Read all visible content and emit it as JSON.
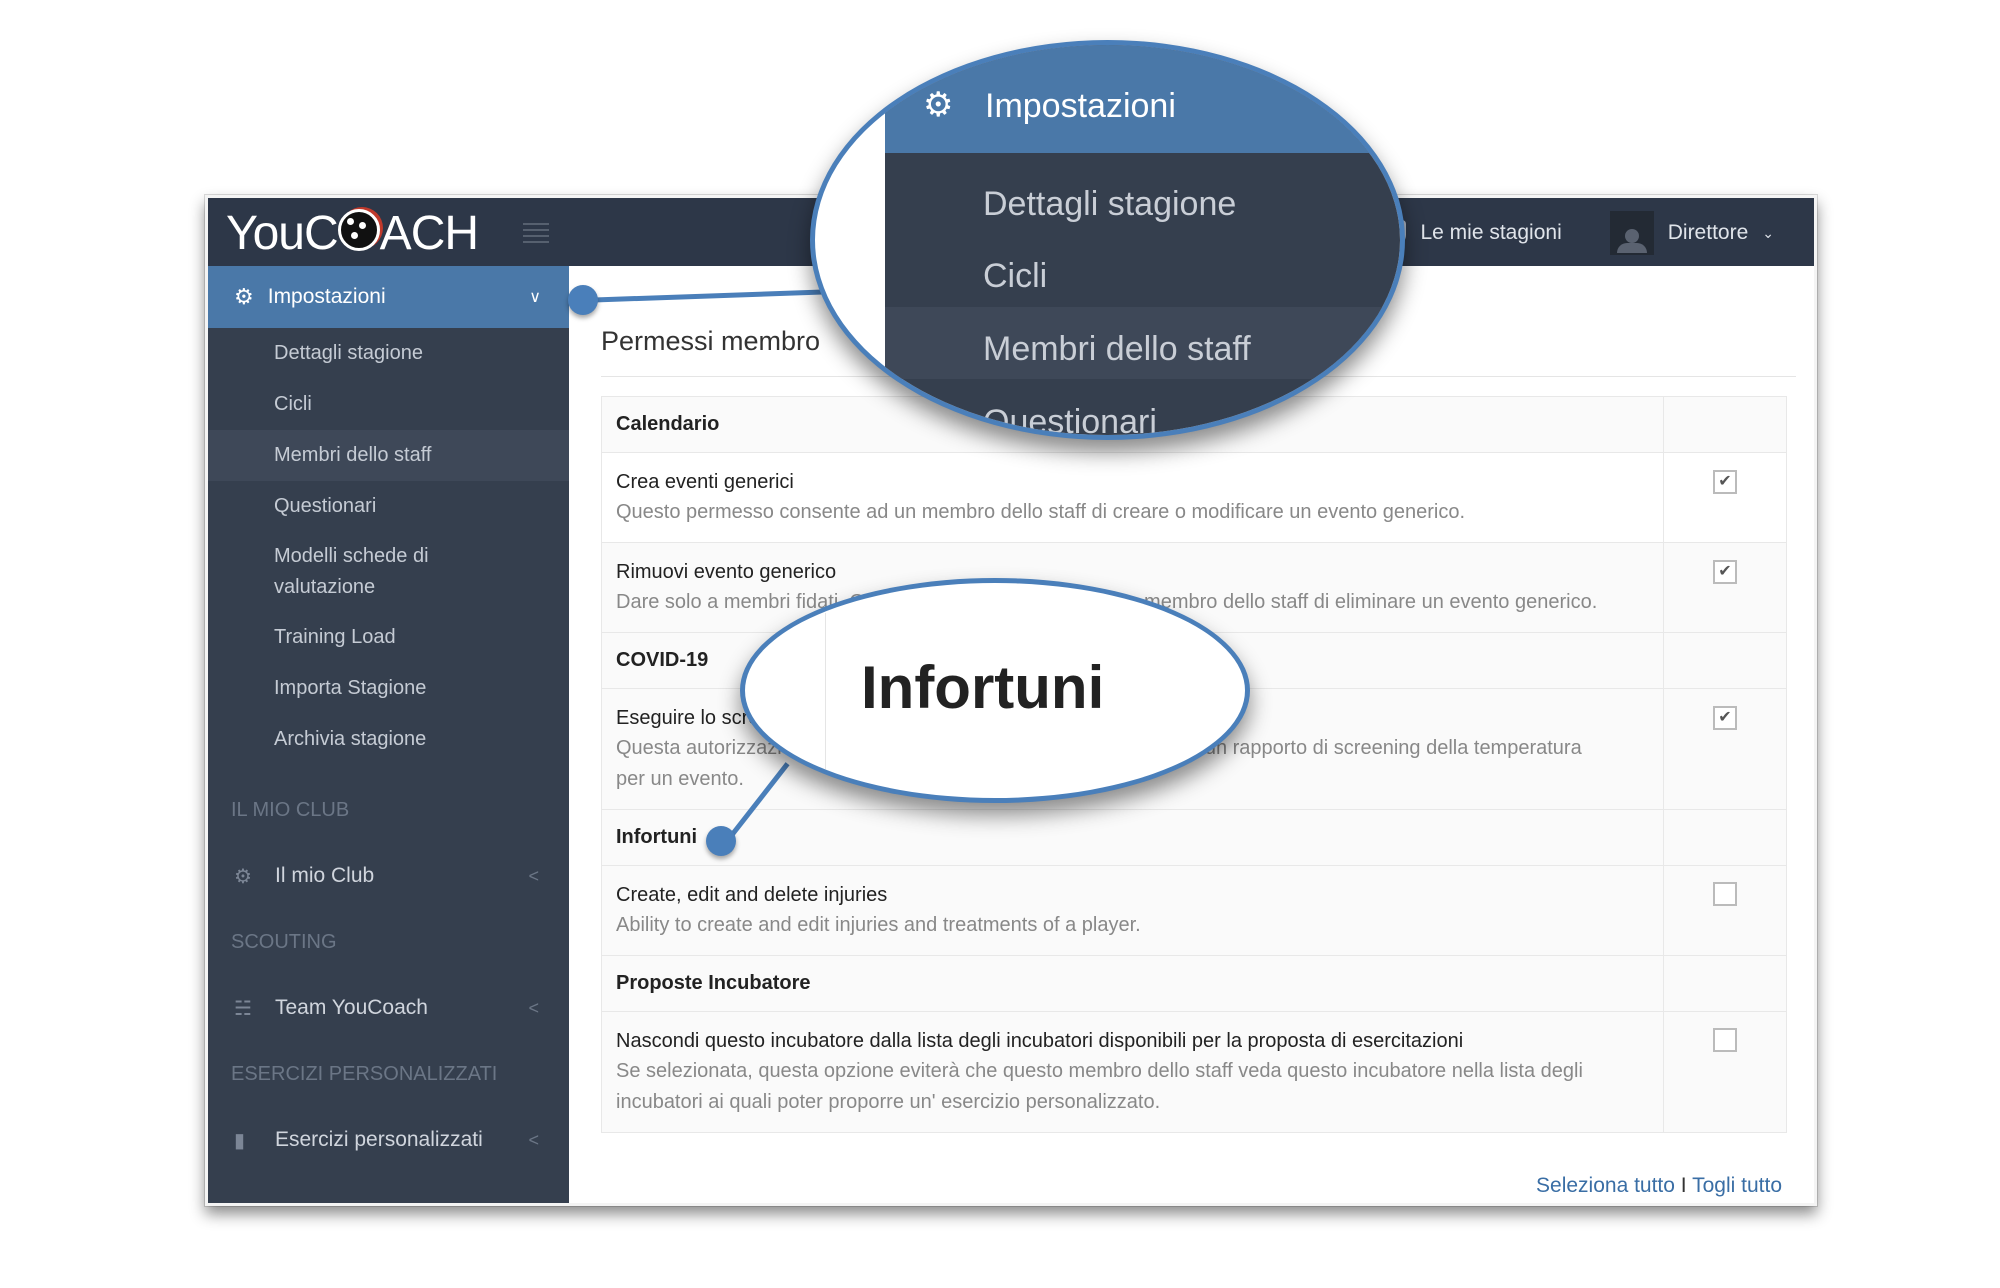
{
  "app": {
    "logo_text_left": "YouC",
    "logo_text_right": "ACH"
  },
  "topbar": {
    "seasons_label": "Le mie stagioni",
    "user_label": "Direttore",
    "icons": {
      "seasons": "shield-icon",
      "user": "avatar-icon",
      "menu": "hamburger-icon"
    }
  },
  "sidebar": {
    "active_section": {
      "label": "Impostazioni",
      "icon": "gear-icon"
    },
    "sub_items": [
      {
        "label": "Dettagli stagione"
      },
      {
        "label": "Cicli"
      },
      {
        "label": "Membri dello staff",
        "selected": true
      },
      {
        "label": "Questionari"
      },
      {
        "label": "Modelli schede di valutazione"
      },
      {
        "label": "Training Load"
      },
      {
        "label": "Importa Stagione"
      },
      {
        "label": "Archivia stagione"
      }
    ],
    "groups": [
      {
        "header": "IL MIO CLUB",
        "item": {
          "label": "Il mio Club",
          "icon": "gear-icon"
        }
      },
      {
        "header": "SCOUTING",
        "item": {
          "label": "Team YouCoach",
          "icon": "binoculars-icon"
        }
      },
      {
        "header": "ESERCIZI PERSONALIZZATI",
        "item": {
          "label": "Esercizi personalizzati",
          "icon": "clipboard-icon"
        }
      }
    ]
  },
  "main": {
    "title": "Permessi membro",
    "sections": [
      {
        "category": "Calendario",
        "permissions": [
          {
            "title": "Crea eventi generici",
            "description": "Questo permesso consente ad un membro dello staff di creare o modificare un evento generico.",
            "checked": true
          },
          {
            "title": "Rimuovi evento generico",
            "description": "Dare solo a membri fidati. Questo permesso consente a un membro dello staff di eliminare un evento generico.",
            "checked": true
          }
        ]
      },
      {
        "category": "COVID-19",
        "permissions": [
          {
            "title": "Eseguire lo screening",
            "description": "Questa autorizzazione consente ai membri dello staff di compilare un rapporto di screening della temperatura per un evento.",
            "checked": true
          }
        ]
      },
      {
        "category": "Infortuni",
        "permissions": [
          {
            "title": "Create, edit and delete injuries",
            "description": "Ability to create and edit injuries and treatments of a player.",
            "checked": false
          }
        ]
      },
      {
        "category": "Proposte Incubatore",
        "permissions": [
          {
            "title": "Nascondi questo incubatore dalla lista degli incubatori disponibili per la proposta di esercitazioni",
            "description": "Se selezionata, questa opzione eviterà che questo membro dello staff veda questo incubatore nella lista degli incubatori ai quali poter proporre un' esercizio personalizzato.",
            "checked": false
          }
        ]
      }
    ],
    "select_all": "Seleziona tutto",
    "separator": "I",
    "deselect_all": "Togli tutto"
  },
  "callouts": {
    "magnifier_top": {
      "header": "Impostazioni",
      "items": [
        "Dettagli stagione",
        "Cicli",
        "Membri dello staff",
        "Questionari"
      ]
    },
    "magnifier_bottom": {
      "label": "Infortuni"
    }
  },
  "colors": {
    "accent": "#4a78a8",
    "sidebar_bg": "#353f4e",
    "topbar_bg": "#2d3748",
    "link": "#3a6ea5",
    "callout_border": "#4a7fba"
  }
}
